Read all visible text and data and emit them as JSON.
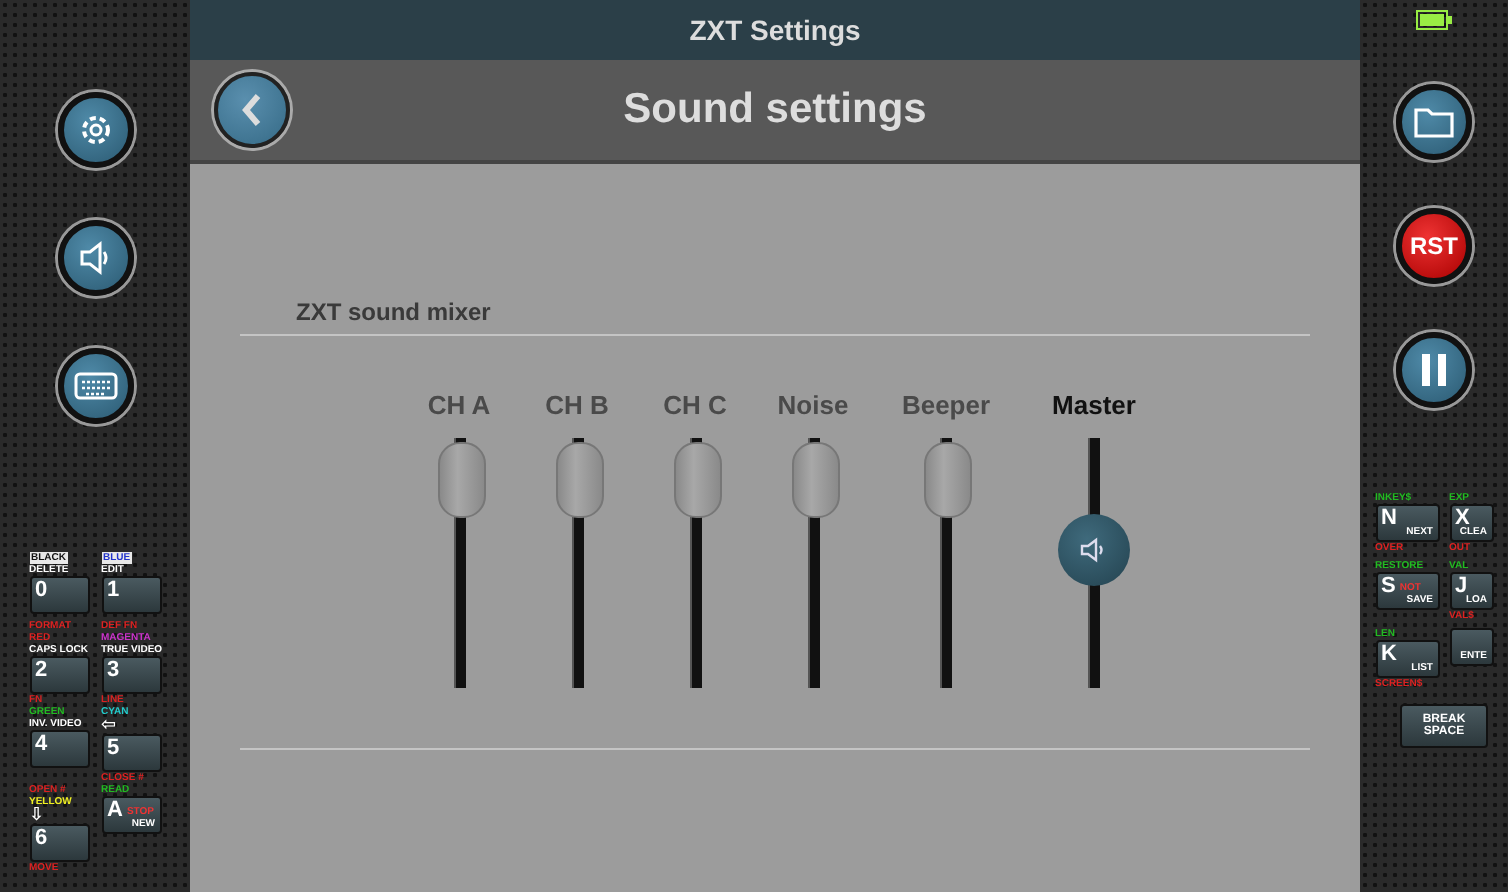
{
  "window": {
    "title": "ZXT Settings"
  },
  "header": {
    "title": "Sound settings"
  },
  "left_buttons": [
    {
      "kind": "settings"
    },
    {
      "kind": "sound"
    },
    {
      "kind": "keyboard"
    }
  ],
  "right_buttons": [
    {
      "kind": "folder"
    },
    {
      "kind": "reset",
      "label": "RST"
    },
    {
      "kind": "pause"
    }
  ],
  "mixer": {
    "title": "ZXT sound mixer",
    "channels": [
      {
        "name": "CH A",
        "level": 1,
        "master": false
      },
      {
        "name": "CH B",
        "level": 1,
        "master": false
      },
      {
        "name": "CH C",
        "level": 1,
        "master": false
      },
      {
        "name": "Noise",
        "level": 1,
        "master": false
      },
      {
        "name": "Beeper",
        "level": 1,
        "master": false
      },
      {
        "name": "Master",
        "level": 0.6,
        "master": true
      }
    ]
  },
  "left_keys": [
    {
      "main": "0",
      "above": [
        {
          "text": "BLACK",
          "color": "#111111"
        },
        {
          "text": "DELETE",
          "color": "#ffffff"
        }
      ]
    },
    {
      "main": "1",
      "above": [
        {
          "text": "BLUE",
          "color": "#2233cc"
        },
        {
          "text": "EDIT",
          "color": "#ffffff"
        }
      ]
    },
    {
      "main": "2",
      "above": [
        {
          "text": "FORMAT",
          "color": "#dd2222"
        },
        {
          "text": "RED",
          "color": "#dd2222"
        },
        {
          "text": "CAPS LOCK",
          "color": "#ffffff"
        }
      ]
    },
    {
      "main": "3",
      "above": [
        {
          "text": "DEF FN",
          "color": "#dd2222"
        },
        {
          "text": "MAGENTA",
          "color": "#cc33cc"
        },
        {
          "text": "TRUE VIDEO",
          "color": "#ffffff"
        }
      ]
    },
    {
      "main": "4",
      "above": [
        {
          "text": "FN",
          "color": "#dd2222"
        },
        {
          "text": "GREEN",
          "color": "#22bb22"
        },
        {
          "text": "INV. VIDEO",
          "color": "#ffffff"
        }
      ]
    },
    {
      "main": "5",
      "above": [
        {
          "text": "LINE",
          "color": "#dd2222"
        },
        {
          "text": "CYAN",
          "color": "#22cccc"
        },
        {
          "text": "⇦",
          "color": "#ffffff"
        }
      ],
      "below": [
        {
          "text": "CLOSE #",
          "color": "#dd2222"
        }
      ]
    },
    {
      "main": "6",
      "above": [
        {
          "text": "OPEN #",
          "color": "#dd2222"
        },
        {
          "text": "YELLOW",
          "color": "#eeee22"
        },
        {
          "text": "⇩",
          "color": "#ffffff"
        }
      ],
      "below": [
        {
          "text": "MOVE",
          "color": "#dd2222"
        }
      ]
    },
    {
      "main": "A",
      "inner": "STOP",
      "word": "NEW",
      "above": [
        {
          "text": "READ",
          "color": "#22bb22"
        }
      ]
    }
  ],
  "right_keys": [
    {
      "main": "N",
      "word": "NEXT",
      "above": [
        {
          "text": "INKEY$",
          "color": "#22bb22"
        }
      ],
      "below": [
        {
          "text": "OVER",
          "color": "#dd2222"
        }
      ]
    },
    {
      "main": "X",
      "word": "CLEA",
      "above": [
        {
          "text": "EXP",
          "color": "#22bb22"
        }
      ],
      "below": [
        {
          "text": "OUT",
          "color": "#dd2222"
        }
      ]
    },
    {
      "main": "S",
      "inner": "NOT",
      "word": "SAVE",
      "above": [
        {
          "text": "RESTORE",
          "color": "#22bb22"
        }
      ]
    },
    {
      "main": "J",
      "word": "LOA",
      "above": [
        {
          "text": "VAL",
          "color": "#22bb22"
        }
      ],
      "below": [
        {
          "text": "VAL$",
          "color": "#dd2222"
        }
      ]
    },
    {
      "main": "K",
      "word": "LIST",
      "above": [
        {
          "text": "LEN",
          "color": "#22bb22"
        }
      ],
      "below": [
        {
          "text": "SCREEN$",
          "color": "#dd2222"
        }
      ]
    },
    {
      "word": "ENTE"
    }
  ],
  "space_key": {
    "lines": [
      "BREAK",
      "SPACE"
    ]
  }
}
